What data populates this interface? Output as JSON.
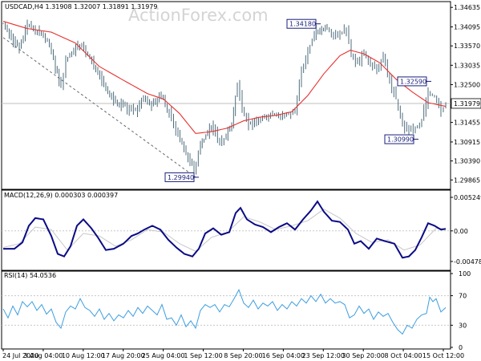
{
  "header": {
    "symbol": "USDCAD,H4",
    "ohlc": "1.31908 1.32007 1.31891 1.31979",
    "watermark": "ActionForex.com"
  },
  "colors": {
    "candle": "#4f6d7d",
    "ma": "#e8312f",
    "macd": "#0b0b86",
    "signal": "#c7c7c7",
    "rsi": "#3d9ee0",
    "annotation": "#1a1f7a",
    "trendline": "#666666",
    "grid": "#c8c8c8",
    "border": "#000000"
  },
  "x_labels": [
    "24 Jul 2020",
    "3 Aug 04:00",
    "10 Aug 12:00",
    "17 Aug 20:00",
    "25 Aug 04:00",
    "1 Sep 12:00",
    "8 Sep 20:00",
    "16 Sep 04:00",
    "23 Sep 12:00",
    "30 Sep 20:00",
    "8 Oct 04:00",
    "15 Oct 12:00"
  ],
  "chart_data": [
    {
      "type": "candlestick",
      "title": "USDCAD,H4 1.31908 1.32007 1.31891 1.31979",
      "ylim": [
        1.2965,
        1.3475
      ],
      "yticks": [
        "1.34635",
        "1.34095",
        "1.33570",
        "1.33035",
        "1.32500",
        "1.31979",
        "1.31455",
        "1.30915",
        "1.30390",
        "1.29865"
      ],
      "current_price": "1.31979",
      "price_path": [
        [
          0,
          1.342
        ],
        [
          10,
          1.338
        ],
        [
          20,
          1.335
        ],
        [
          30,
          1.3415
        ],
        [
          40,
          1.3395
        ],
        [
          55,
          1.3375
        ],
        [
          65,
          1.33
        ],
        [
          72,
          1.3245
        ],
        [
          78,
          1.332
        ],
        [
          88,
          1.3345
        ],
        [
          98,
          1.336
        ],
        [
          108,
          1.332
        ],
        [
          118,
          1.328
        ],
        [
          128,
          1.324
        ],
        [
          140,
          1.32
        ],
        [
          152,
          1.319
        ],
        [
          165,
          1.318
        ],
        [
          175,
          1.321
        ],
        [
          185,
          1.3195
        ],
        [
          197,
          1.322
        ],
        [
          207,
          1.317
        ],
        [
          218,
          1.311
        ],
        [
          228,
          1.306
        ],
        [
          238,
          1.3015
        ],
        [
          246,
          1.308
        ],
        [
          255,
          1.312
        ],
        [
          262,
          1.313
        ],
        [
          270,
          1.3085
        ],
        [
          278,
          1.311
        ],
        [
          285,
          1.314
        ],
        [
          292,
          1.3255
        ],
        [
          298,
          1.318
        ],
        [
          306,
          1.314
        ],
        [
          316,
          1.315
        ],
        [
          326,
          1.3165
        ],
        [
          336,
          1.317
        ],
        [
          346,
          1.3165
        ],
        [
          356,
          1.317
        ],
        [
          364,
          1.318
        ],
        [
          372,
          1.329
        ],
        [
          380,
          1.334
        ],
        [
          388,
          1.339
        ],
        [
          395,
          1.34
        ],
        [
          404,
          1.3405
        ],
        [
          412,
          1.3385
        ],
        [
          420,
          1.339
        ],
        [
          428,
          1.3405
        ],
        [
          434,
          1.333
        ],
        [
          442,
          1.331
        ],
        [
          450,
          1.334
        ],
        [
          458,
          1.33
        ],
        [
          466,
          1.329
        ],
        [
          474,
          1.333
        ],
        [
          482,
          1.326
        ],
        [
          490,
          1.321
        ],
        [
          498,
          1.314
        ],
        [
          506,
          1.312
        ],
        [
          514,
          1.313
        ],
        [
          522,
          1.315
        ],
        [
          530,
          1.323
        ],
        [
          538,
          1.3215
        ],
        [
          546,
          1.3175
        ],
        [
          552,
          1.3198
        ]
      ],
      "ma_path": [
        [
          0,
          1.3425
        ],
        [
          30,
          1.3405
        ],
        [
          60,
          1.3395
        ],
        [
          90,
          1.3365
        ],
        [
          120,
          1.33
        ],
        [
          150,
          1.3262
        ],
        [
          180,
          1.3225
        ],
        [
          200,
          1.321
        ],
        [
          220,
          1.317
        ],
        [
          240,
          1.3115
        ],
        [
          260,
          1.312
        ],
        [
          280,
          1.313
        ],
        [
          300,
          1.315
        ],
        [
          320,
          1.316
        ],
        [
          340,
          1.3165
        ],
        [
          360,
          1.3175
        ],
        [
          380,
          1.322
        ],
        [
          400,
          1.328
        ],
        [
          420,
          1.333
        ],
        [
          433,
          1.3345
        ],
        [
          450,
          1.3335
        ],
        [
          470,
          1.331
        ],
        [
          490,
          1.3265
        ],
        [
          510,
          1.323
        ],
        [
          530,
          1.32
        ],
        [
          552,
          1.319
        ]
      ],
      "annotations": [
        {
          "label": "1.34180",
          "x": 392,
          "y": 1.3418,
          "side": "left"
        },
        {
          "label": "1.32590",
          "x": 530,
          "y": 1.3259,
          "side": "left"
        },
        {
          "label": "1.30990",
          "x": 514,
          "y": 1.3099,
          "side": "left"
        },
        {
          "label": "1.29940",
          "x": 240,
          "y": 1.2994,
          "side": "left"
        }
      ],
      "trendline": [
        [
          0,
          1.338
        ],
        [
          240,
          1.2994
        ]
      ]
    },
    {
      "type": "line",
      "title": "MACD(12,26,9) 0.000303 0.000397",
      "ylim": [
        -0.0058,
        0.006
      ],
      "yticks": [
        {
          "label": "0.005249",
          "v": 0.005249
        },
        {
          "label": "0.00",
          "v": 0.0
        },
        {
          "label": "-0.004785",
          "v": -0.004785
        }
      ],
      "macd_path": [
        [
          0,
          -0.0028
        ],
        [
          14,
          -0.0028
        ],
        [
          24,
          -0.0018
        ],
        [
          32,
          0.0008
        ],
        [
          40,
          0.002
        ],
        [
          50,
          0.0018
        ],
        [
          60,
          -0.0008
        ],
        [
          68,
          -0.0036
        ],
        [
          76,
          -0.004
        ],
        [
          84,
          -0.0024
        ],
        [
          92,
          0.0008
        ],
        [
          100,
          0.0018
        ],
        [
          110,
          0.0004
        ],
        [
          118,
          -0.001
        ],
        [
          128,
          -0.003
        ],
        [
          138,
          -0.0028
        ],
        [
          150,
          -0.002
        ],
        [
          160,
          -0.0008
        ],
        [
          168,
          -0.0004
        ],
        [
          176,
          0.0002
        ],
        [
          186,
          0.0008
        ],
        [
          196,
          0.0002
        ],
        [
          206,
          -0.0014
        ],
        [
          216,
          -0.0026
        ],
        [
          226,
          -0.0036
        ],
        [
          236,
          -0.004
        ],
        [
          244,
          -0.0028
        ],
        [
          252,
          -0.0004
        ],
        [
          262,
          0.0004
        ],
        [
          272,
          -0.0006
        ],
        [
          282,
          -0.0002
        ],
        [
          290,
          0.0028
        ],
        [
          296,
          0.0036
        ],
        [
          304,
          0.0018
        ],
        [
          314,
          0.001
        ],
        [
          324,
          0.0006
        ],
        [
          334,
          -0.0002
        ],
        [
          344,
          0.0006
        ],
        [
          354,
          0.0012
        ],
        [
          364,
          0.0002
        ],
        [
          374,
          0.0018
        ],
        [
          384,
          0.0032
        ],
        [
          392,
          0.0046
        ],
        [
          400,
          0.003
        ],
        [
          410,
          0.0016
        ],
        [
          420,
          0.0014
        ],
        [
          430,
          0.0002
        ],
        [
          438,
          -0.002
        ],
        [
          446,
          -0.0016
        ],
        [
          456,
          -0.0028
        ],
        [
          466,
          -0.0012
        ],
        [
          476,
          -0.0016
        ],
        [
          488,
          -0.002
        ],
        [
          498,
          -0.0042
        ],
        [
          506,
          -0.004
        ],
        [
          514,
          -0.003
        ],
        [
          522,
          -0.001
        ],
        [
          530,
          0.0012
        ],
        [
          538,
          0.0008
        ],
        [
          546,
          0.0002
        ],
        [
          552,
          0.0003
        ]
      ],
      "signal_path": [
        [
          0,
          -0.0026
        ],
        [
          20,
          -0.002
        ],
        [
          40,
          0.0006
        ],
        [
          60,
          0.0002
        ],
        [
          80,
          -0.003
        ],
        [
          100,
          -0.0004
        ],
        [
          120,
          -0.0008
        ],
        [
          140,
          -0.0024
        ],
        [
          160,
          -0.0014
        ],
        [
          180,
          0.0002
        ],
        [
          200,
          -0.0002
        ],
        [
          220,
          -0.002
        ],
        [
          240,
          -0.0032
        ],
        [
          260,
          -0.001
        ],
        [
          280,
          -0.0002
        ],
        [
          300,
          0.0022
        ],
        [
          320,
          0.0014
        ],
        [
          340,
          0.0002
        ],
        [
          360,
          0.0008
        ],
        [
          380,
          0.0016
        ],
        [
          400,
          0.0034
        ],
        [
          420,
          0.002
        ],
        [
          440,
          -0.0004
        ],
        [
          460,
          -0.0018
        ],
        [
          480,
          -0.0014
        ],
        [
          500,
          -0.003
        ],
        [
          520,
          -0.0022
        ],
        [
          540,
          0.0004
        ],
        [
          552,
          0.0004
        ]
      ]
    },
    {
      "type": "line",
      "title": "RSI(14) 54.0536",
      "ylim": [
        0,
        100
      ],
      "yticks": [
        {
          "label": "100",
          "v": 100
        },
        {
          "label": "70",
          "v": 70
        },
        {
          "label": "30",
          "v": 30
        },
        {
          "label": "0",
          "v": 0
        }
      ],
      "rsi_path": [
        [
          0,
          52
        ],
        [
          6,
          40
        ],
        [
          12,
          56
        ],
        [
          18,
          44
        ],
        [
          24,
          62
        ],
        [
          30,
          55
        ],
        [
          36,
          62
        ],
        [
          42,
          50
        ],
        [
          48,
          58
        ],
        [
          54,
          45
        ],
        [
          60,
          52
        ],
        [
          66,
          34
        ],
        [
          72,
          26
        ],
        [
          78,
          48
        ],
        [
          84,
          56
        ],
        [
          90,
          52
        ],
        [
          96,
          66
        ],
        [
          102,
          54
        ],
        [
          108,
          50
        ],
        [
          114,
          42
        ],
        [
          120,
          52
        ],
        [
          126,
          38
        ],
        [
          132,
          46
        ],
        [
          138,
          36
        ],
        [
          144,
          44
        ],
        [
          150,
          40
        ],
        [
          156,
          50
        ],
        [
          162,
          42
        ],
        [
          168,
          54
        ],
        [
          174,
          46
        ],
        [
          180,
          56
        ],
        [
          186,
          50
        ],
        [
          192,
          44
        ],
        [
          198,
          58
        ],
        [
          204,
          38
        ],
        [
          210,
          40
        ],
        [
          216,
          30
        ],
        [
          222,
          44
        ],
        [
          228,
          28
        ],
        [
          234,
          36
        ],
        [
          240,
          26
        ],
        [
          246,
          50
        ],
        [
          252,
          58
        ],
        [
          258,
          54
        ],
        [
          264,
          58
        ],
        [
          270,
          48
        ],
        [
          276,
          58
        ],
        [
          282,
          55
        ],
        [
          288,
          66
        ],
        [
          294,
          78
        ],
        [
          300,
          60
        ],
        [
          306,
          54
        ],
        [
          312,
          64
        ],
        [
          318,
          52
        ],
        [
          324,
          60
        ],
        [
          330,
          56
        ],
        [
          336,
          62
        ],
        [
          342,
          50
        ],
        [
          348,
          58
        ],
        [
          354,
          52
        ],
        [
          360,
          62
        ],
        [
          366,
          56
        ],
        [
          372,
          66
        ],
        [
          378,
          60
        ],
        [
          384,
          70
        ],
        [
          390,
          62
        ],
        [
          396,
          72
        ],
        [
          402,
          60
        ],
        [
          408,
          66
        ],
        [
          414,
          60
        ],
        [
          420,
          62
        ],
        [
          426,
          58
        ],
        [
          432,
          40
        ],
        [
          438,
          44
        ],
        [
          444,
          56
        ],
        [
          450,
          46
        ],
        [
          456,
          52
        ],
        [
          462,
          38
        ],
        [
          468,
          48
        ],
        [
          474,
          42
        ],
        [
          480,
          46
        ],
        [
          486,
          34
        ],
        [
          492,
          24
        ],
        [
          498,
          18
        ],
        [
          504,
          30
        ],
        [
          510,
          26
        ],
        [
          516,
          38
        ],
        [
          522,
          44
        ],
        [
          528,
          46
        ],
        [
          532,
          68
        ],
        [
          536,
          62
        ],
        [
          540,
          66
        ],
        [
          546,
          48
        ],
        [
          552,
          54
        ]
      ]
    }
  ]
}
